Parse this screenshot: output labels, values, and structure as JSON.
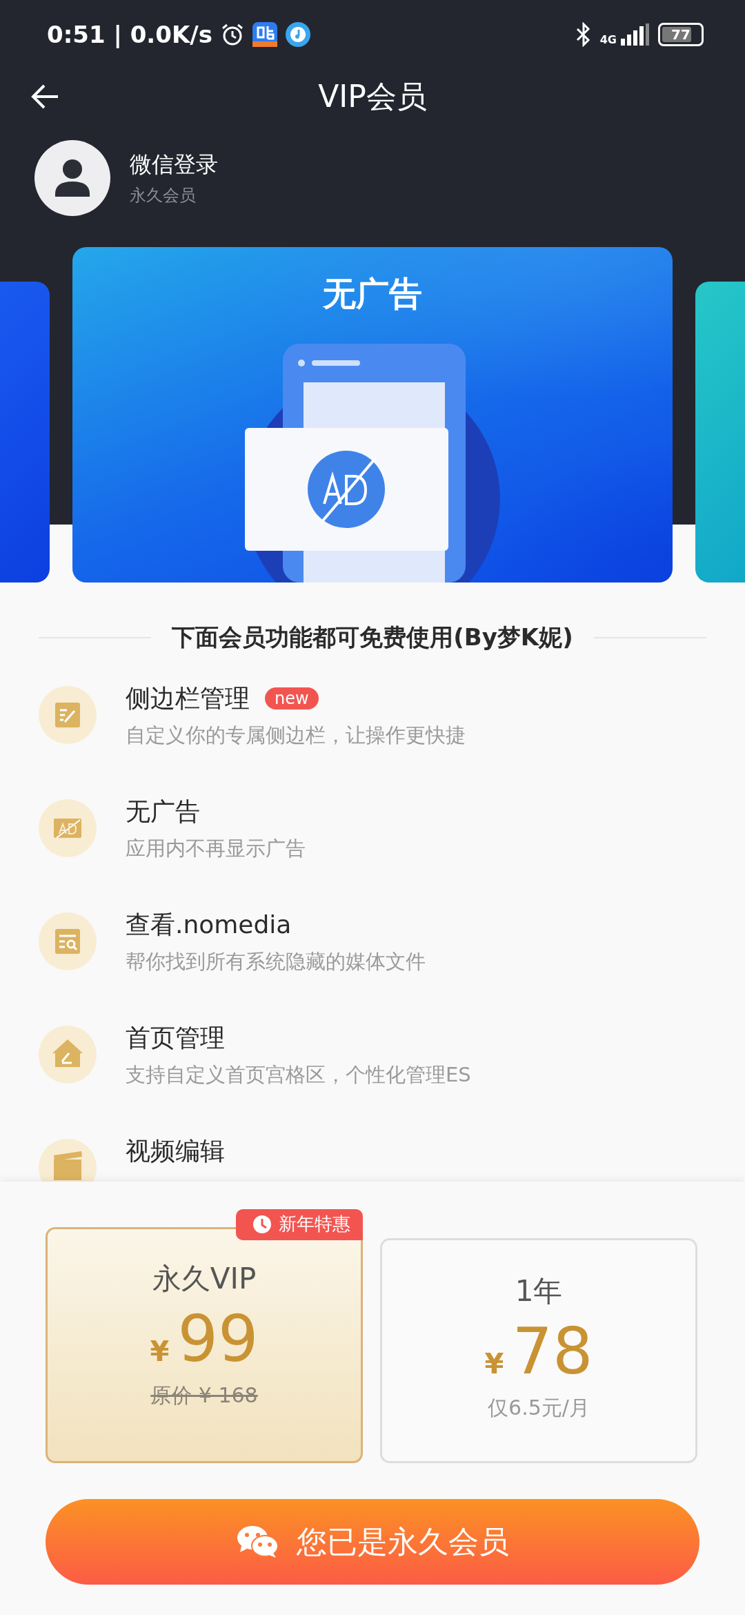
{
  "status_bar": {
    "time_speed": "0:51 | 0.0K/s",
    "network": "4G",
    "battery": "77"
  },
  "header": {
    "title": "VIP会员"
  },
  "profile": {
    "name": "微信登录",
    "membership": "永久会员"
  },
  "banner": {
    "title": "无广告"
  },
  "features_heading": "下面会员功能都可免费使用(By梦K妮)",
  "features": [
    {
      "title": "侧边栏管理",
      "badge": "new",
      "description": "自定义你的专属侧边栏，让操作更快捷"
    },
    {
      "title": "无广告",
      "description": "应用内不再显示广告"
    },
    {
      "title": "查看.nomedia",
      "description": "帮你找到所有系统隐藏的媒体文件"
    },
    {
      "title": "首页管理",
      "description": "支持自定义首页宫格区，个性化管理ES"
    },
    {
      "title": "视频编辑"
    }
  ],
  "plans": [
    {
      "name": "永久VIP",
      "currency": "¥",
      "price": "99",
      "note": "原价 ¥ 168",
      "note_struck": true,
      "tag": "新年特惠",
      "selected": true
    },
    {
      "name": "1年",
      "currency": "¥",
      "price": "78",
      "note": "仅6.5元/月",
      "note_struck": false,
      "selected": false
    }
  ],
  "action_button": "您已是永久会员"
}
